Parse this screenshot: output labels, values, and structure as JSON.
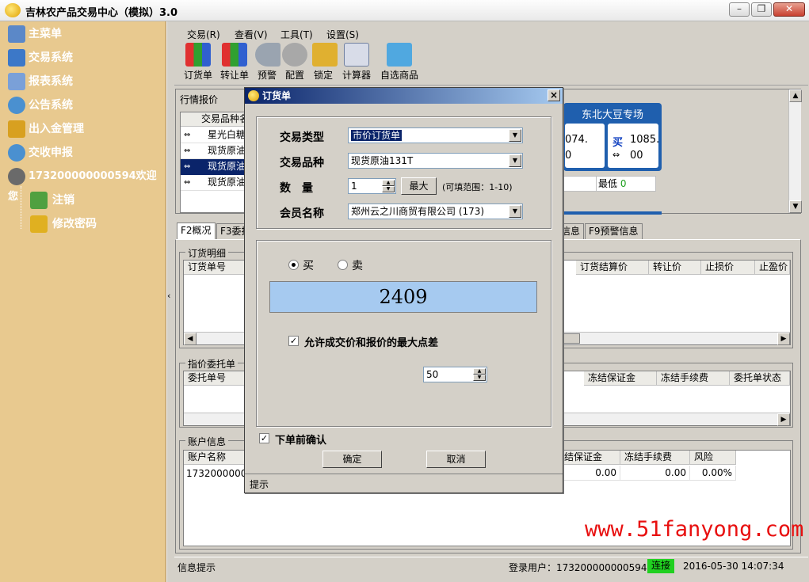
{
  "window": {
    "title": "吉林农产品交易中心（模拟）3.0"
  },
  "sidebar": {
    "items": [
      {
        "label": "主菜单",
        "icon": "home-icon",
        "color": "#5b88c8"
      },
      {
        "label": "交易系统",
        "icon": "monitor-icon",
        "color": "#3c78c8"
      },
      {
        "label": "报表系统",
        "icon": "chart-icon",
        "color": "#7aa0d8"
      },
      {
        "label": "公告系统",
        "icon": "chat-icon",
        "color": "#4a90d0"
      },
      {
        "label": "出入金管理",
        "icon": "coins-icon",
        "color": "#d8a020"
      },
      {
        "label": "交收申报",
        "icon": "chat-icon",
        "color": "#4a90d0"
      },
      {
        "label": "173200000000594欢迎您",
        "icon": "cup-icon",
        "color": "#6a6a6a"
      }
    ],
    "sub_items": [
      {
        "label": "注销",
        "icon": "user-icon"
      },
      {
        "label": "修改密码",
        "icon": "key-icon"
      }
    ]
  },
  "menu": [
    "交易(R)",
    "查看(V)",
    "工具(T)",
    "设置(S)"
  ],
  "toolbar": [
    {
      "label": "订货单",
      "icon": "order-icon"
    },
    {
      "label": "转让单",
      "icon": "transfer-icon"
    },
    {
      "label": "预警",
      "icon": "alarm-icon"
    },
    {
      "label": "配置",
      "icon": "gear-icon"
    },
    {
      "label": "锁定",
      "icon": "lock-icon"
    },
    {
      "label": "计算器",
      "icon": "calculator-icon"
    },
    {
      "label": "自选商品",
      "icon": "cart-icon"
    }
  ],
  "quotes": {
    "title": "行情报价",
    "column": "交易品种名",
    "rows": [
      "星光白糖",
      "现货原油",
      "现货原油",
      "现货原油"
    ],
    "card_title": "东北大豆专场",
    "card_sell": "074.",
    "card_sell2": "0",
    "card_buy_label": "买",
    "card_buy": "1085.",
    "card_buy2": "00",
    "low_label": "最低",
    "low_value": "0"
  },
  "tabs": [
    "F2概况",
    "F3委托",
    "信息",
    "F9预警信息"
  ],
  "order_detail": {
    "title": "订货明细",
    "col_first": "订货单号",
    "cols_right": [
      "订货结算价",
      "转让价",
      "止损价",
      "止盈价"
    ]
  },
  "entrust": {
    "title": "指价委托单",
    "col_first": "委托单号",
    "cols_right": [
      "冻结保证金",
      "冻结手续费",
      "委托单状态"
    ]
  },
  "account": {
    "title": "账户信息",
    "col_first": "账户名称",
    "row_first": "173200000000",
    "cols_right": [
      "结保证金",
      "冻结手续费",
      "风险"
    ],
    "vals_right": [
      "0.00",
      "0.00",
      "0.00%"
    ]
  },
  "status": {
    "info": "信息提示",
    "user": "登录用户：173200000000594",
    "conn": "连接",
    "conn_color": "#20d020",
    "datetime": "2016-05-30 14:07:34"
  },
  "watermark": "www.51fanyong.com",
  "dialog": {
    "title": "订货单",
    "trade_type_label": "交易类型",
    "trade_type_value": "市价订货单",
    "product_label": "交易品种",
    "product_value": "现货原油131T",
    "qty_label": "数　量",
    "qty_value": "1",
    "max_button": "最大",
    "range_hint": "(可填范围：1-10)",
    "member_label": "会员名称",
    "member_value": "郑州云之川商贸有限公司 (173)",
    "buy_label": "买",
    "sell_label": "卖",
    "price": "2409",
    "allow_diff_label": "允许成交价和报价的最大点差",
    "diff_value": "50",
    "confirm_label": "下单前确认",
    "ok": "确定",
    "cancel": "取消",
    "hint": "提示"
  }
}
